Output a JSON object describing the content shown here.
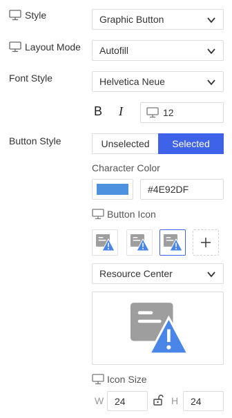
{
  "rows": {
    "style": {
      "label": "Style",
      "value": "Graphic Button"
    },
    "layout_mode": {
      "label": "Layout Mode",
      "value": "Autofill"
    },
    "font_style": {
      "label": "Font Style",
      "value": "Helvetica Neue"
    }
  },
  "text_format": {
    "bold": "B",
    "italic": "I",
    "font_size": "12"
  },
  "button_style": {
    "label": "Button Style",
    "unselected": "Unselected",
    "selected": "Selected"
  },
  "character_color": {
    "label": "Character Color",
    "hex": "#4E92DF",
    "swatch_color": "#4E92DF"
  },
  "button_icon": {
    "label": "Button Icon",
    "category": "Resource Center"
  },
  "icon_size": {
    "label": "Icon Size",
    "w_label": "W",
    "w_value": "24",
    "h_label": "H",
    "h_value": "24"
  },
  "colors": {
    "accent": "#3E62E8",
    "icon_gray": "#9E9E9E",
    "icon_blue": "#4A86E8"
  }
}
